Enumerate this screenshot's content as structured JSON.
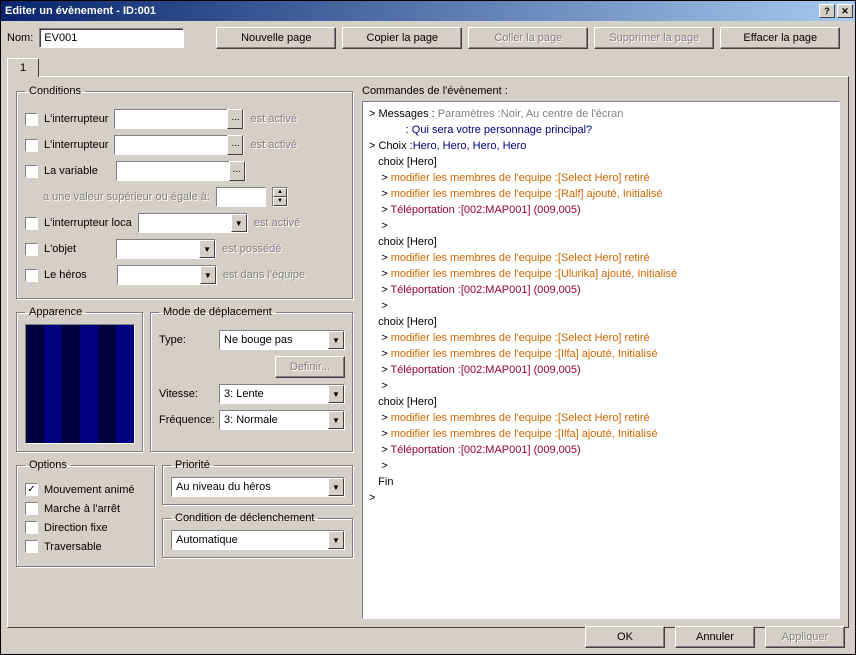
{
  "window": {
    "title": "Editer un évènement - ID:001"
  },
  "toprow": {
    "name_label": "Nom:",
    "name_value": "EV001",
    "buttons": {
      "new_page": "Nouvelle page",
      "copy_page": "Copier la page",
      "paste_page": "Coller la page",
      "delete_page": "Supprimer la page",
      "clear_page": "Effacer la page"
    }
  },
  "tab_label": "1",
  "conditions": {
    "legend": "Conditions",
    "switch1_label": "L'interrupteur",
    "switch2_label": "L'interrupteur",
    "variable_label": "La variable",
    "is_on": "est activé",
    "value_gte": "a une valeur supérieur ou égale à:",
    "local_switch_label": "L'interrupteur loca",
    "item_label": "L'objet",
    "possessed": "est possédé",
    "hero_label": "Le héros",
    "in_party": "est dans l'équipe"
  },
  "appearance": {
    "legend": "Apparence"
  },
  "movement": {
    "legend": "Mode de déplacement",
    "type_label": "Type:",
    "type_value": "Ne bouge pas",
    "define_btn": "Definir...",
    "speed_label": "Vitesse:",
    "speed_value": "3: Lente",
    "freq_label": "Fréquence:",
    "freq_value": "3: Normale"
  },
  "options": {
    "legend": "Options",
    "anim_move": "Mouvement animé",
    "anim_stop": "Marche à l'arrêt",
    "dir_fix": "Direction fixe",
    "through": "Traversable"
  },
  "priority": {
    "legend": "Priorité",
    "value": "Au niveau du héros"
  },
  "trigger": {
    "legend": "Condition de déclenchement",
    "value": "Automatique"
  },
  "commands": {
    "label": "Commandes de l'évènement :",
    "lines": [
      {
        "text": "> Messages : ",
        "cls": "c-black",
        "append": [
          {
            "text": "Paramètres :Noir, Au centre de l'écran",
            "cls": "c-gray"
          }
        ]
      },
      {
        "text": "            : ",
        "cls": "c-black",
        "append": [
          {
            "text": "Qui sera votre personnage principal?",
            "cls": "c-navy"
          }
        ]
      },
      {
        "text": "> Choix :",
        "cls": "c-black",
        "append": [
          {
            "text": "Hero, Hero, Hero, Hero",
            "cls": "c-navy"
          }
        ]
      },
      {
        "text": "   choix [Hero]",
        "cls": "c-black"
      },
      {
        "text": "    > ",
        "cls": "c-black",
        "append": [
          {
            "text": "modifier les membres de l'equipe :[Select Hero] retiré",
            "cls": "c-orange"
          }
        ]
      },
      {
        "text": "    > ",
        "cls": "c-black",
        "append": [
          {
            "text": "modifier les membres de l'equipe :[Ralf] ajouté, Initialisé",
            "cls": "c-orange"
          }
        ]
      },
      {
        "text": "    > ",
        "cls": "c-black",
        "append": [
          {
            "text": "Téléportation :[002:MAP001] (009,005)",
            "cls": "c-maroon"
          }
        ]
      },
      {
        "text": "    >",
        "cls": "c-black"
      },
      {
        "text": "   choix [Hero]",
        "cls": "c-black"
      },
      {
        "text": "    > ",
        "cls": "c-black",
        "append": [
          {
            "text": "modifier les membres de l'equipe :[Select Hero] retiré",
            "cls": "c-orange"
          }
        ]
      },
      {
        "text": "    > ",
        "cls": "c-black",
        "append": [
          {
            "text": "modifier les membres de l'equipe :[Ulurika] ajouté, Initialisé",
            "cls": "c-orange"
          }
        ]
      },
      {
        "text": "    > ",
        "cls": "c-black",
        "append": [
          {
            "text": "Téléportation :[002:MAP001] (009,005)",
            "cls": "c-maroon"
          }
        ]
      },
      {
        "text": "    >",
        "cls": "c-black"
      },
      {
        "text": "   choix [Hero]",
        "cls": "c-black"
      },
      {
        "text": "    > ",
        "cls": "c-black",
        "append": [
          {
            "text": "modifier les membres de l'equipe :[Select Hero] retiré",
            "cls": "c-orange"
          }
        ]
      },
      {
        "text": "    > ",
        "cls": "c-black",
        "append": [
          {
            "text": "modifier les membres de l'equipe :[Ilfa] ajouté, Initialisé",
            "cls": "c-orange"
          }
        ]
      },
      {
        "text": "    > ",
        "cls": "c-black",
        "append": [
          {
            "text": "Téléportation :[002:MAP001] (009,005)",
            "cls": "c-maroon"
          }
        ]
      },
      {
        "text": "    >",
        "cls": "c-black"
      },
      {
        "text": "   choix [Hero]",
        "cls": "c-black"
      },
      {
        "text": "    > ",
        "cls": "c-black",
        "append": [
          {
            "text": "modifier les membres de l'equipe :[Select Hero] retiré",
            "cls": "c-orange"
          }
        ]
      },
      {
        "text": "    > ",
        "cls": "c-black",
        "append": [
          {
            "text": "modifier les membres de l'equipe :[Ilfa] ajouté, Initialisé",
            "cls": "c-orange"
          }
        ]
      },
      {
        "text": "    > ",
        "cls": "c-black",
        "append": [
          {
            "text": "Téléportation :[002:MAP001] (009,005)",
            "cls": "c-maroon"
          }
        ]
      },
      {
        "text": "    >",
        "cls": "c-black"
      },
      {
        "text": "   Fin",
        "cls": "c-black"
      },
      {
        "text": ">",
        "cls": "c-black"
      }
    ]
  },
  "bottom": {
    "ok": "OK",
    "cancel": "Annuler",
    "apply": "Appliquer"
  }
}
